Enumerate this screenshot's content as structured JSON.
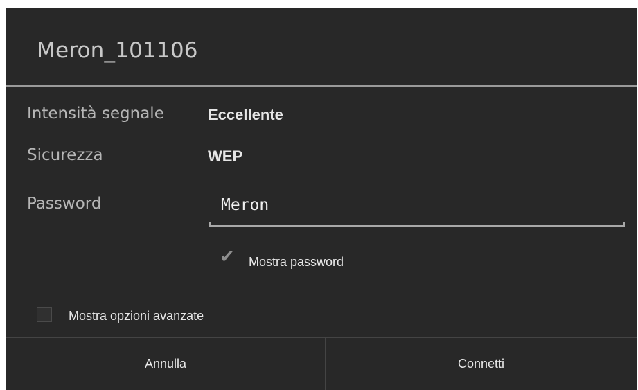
{
  "dialog": {
    "title": "Meron_101106",
    "rows": [
      {
        "label": "Intensità segnale",
        "value": "Eccellente"
      },
      {
        "label": "Sicurezza",
        "value": "WEP"
      }
    ],
    "password": {
      "label": "Password",
      "value": "Meron"
    },
    "show_password": {
      "label": "Mostra password",
      "checked": true
    },
    "advanced_options": {
      "label": "Mostra opzioni avanzate",
      "checked": false
    },
    "buttons": {
      "cancel": "Annulla",
      "connect": "Connetti"
    }
  },
  "colors": {
    "background": "#282828",
    "divider": "#9a9a9a",
    "text": "#e6e6e6"
  },
  "icons": {
    "checkbox_checked": "check-icon"
  }
}
